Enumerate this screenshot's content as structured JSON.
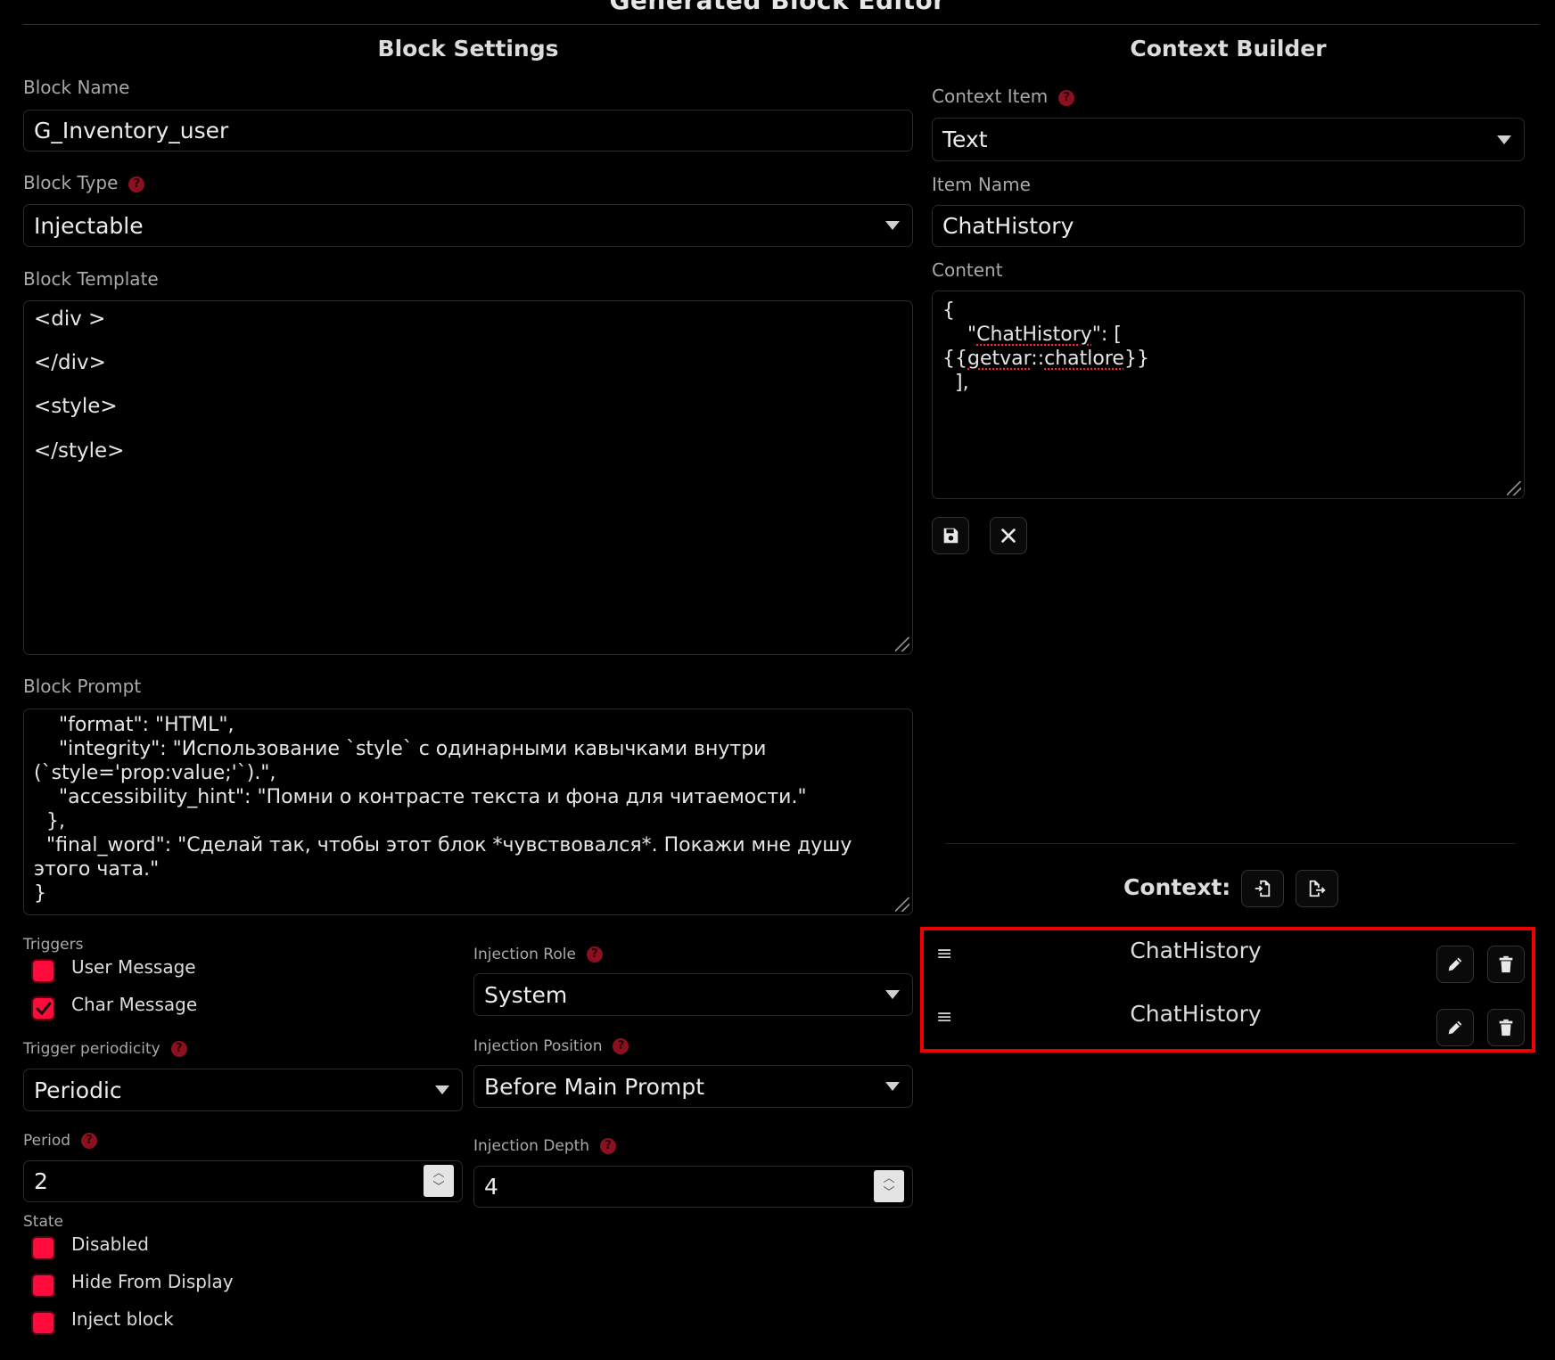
{
  "app": {
    "title": "Generated Block Editor"
  },
  "block_settings": {
    "title": "Block Settings",
    "block_name": {
      "label": "Block Name",
      "value": "G_Inventory_user"
    },
    "block_type": {
      "label": "Block Type",
      "value": "Injectable",
      "help": "?"
    },
    "block_template": {
      "label": "Block Template",
      "value": "<div >\n\n</div>\n\n<style>\n\n</style>"
    },
    "block_prompt": {
      "label": "Block Prompt",
      "value": "    \"format\": \"HTML\",\n    \"integrity\": \"Использование `style` с одинарными кавычками внутри (`style='prop:value;'`).\",\n    \"accessibility_hint\": \"Помни о контрасте текста и фона для читаемости.\"\n  },\n  \"final_word\": \"Сделай так, чтобы этот блок *чувствовался*. Покажи мне душу этого чата.\"\n}"
    },
    "triggers": {
      "label": "Triggers",
      "items": [
        {
          "label": "User Message",
          "checked": false
        },
        {
          "label": "Char Message",
          "checked": true
        }
      ]
    },
    "trigger_periodicity": {
      "label": "Trigger periodicity",
      "value": "Periodic",
      "help": "?"
    },
    "period": {
      "label": "Period",
      "value": "2",
      "help": "?"
    },
    "state": {
      "label": "State",
      "items": [
        {
          "label": "Disabled",
          "checked": false
        },
        {
          "label": "Hide From Display",
          "checked": false
        },
        {
          "label": "Inject block",
          "checked": false
        }
      ]
    },
    "injection_role": {
      "label": "Injection Role",
      "value": "System",
      "help": "?"
    },
    "injection_position": {
      "label": "Injection Position",
      "value": "Before Main Prompt",
      "help": "?"
    },
    "injection_depth": {
      "label": "Injection Depth",
      "value": "4",
      "help": "?"
    }
  },
  "context_builder": {
    "title": "Context Builder",
    "context_item": {
      "label": "Context Item",
      "value": "Text",
      "help": "?"
    },
    "item_name": {
      "label": "Item Name",
      "value": "ChatHistory"
    },
    "content": {
      "label": "Content",
      "line1": "{",
      "line2_pre": "    \"",
      "line2_word": "ChatHistory",
      "line2_post": "\": [",
      "line3_pre": "{{",
      "line3_a": "getvar",
      "line3_mid": "::",
      "line3_b": "chatlore",
      "line3_post": "}}",
      "line4": "  ],"
    },
    "context_label": "Context:",
    "items": [
      {
        "name": "ChatHistory"
      },
      {
        "name": "ChatHistory"
      }
    ]
  },
  "colors": {
    "accent": "#ff0a3a",
    "highlight": "#ee0000",
    "background": "#000000"
  },
  "icons": [
    "save-icon",
    "close-icon",
    "import-icon",
    "export-icon",
    "drag-handle-icon",
    "edit-icon",
    "delete-icon",
    "help-icon",
    "checkmark-icon",
    "dropdown-caret-icon"
  ]
}
